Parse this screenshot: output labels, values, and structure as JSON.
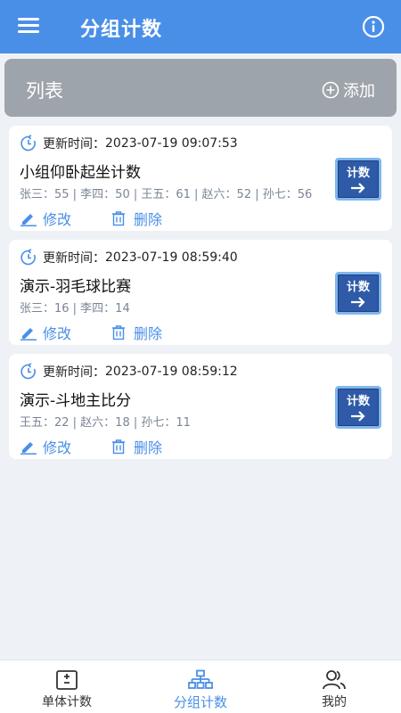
{
  "appbar": {
    "title": "分组计数"
  },
  "list_header": {
    "title": "列表",
    "add_label": "添加"
  },
  "colors": {
    "primary": "#4a8fe7",
    "header_bg": "#9ea4ab",
    "count_button": "#2f5aa8"
  },
  "cards": [
    {
      "time_label": "更新时间：",
      "time": "2023-07-19 09:07:53",
      "name": "小组仰卧起坐计数",
      "scores": "张三：55 | 李四：50 | 王五：61 | 赵六：52 | 孙七：56",
      "edit_label": "修改",
      "delete_label": "删除",
      "count_label": "计数"
    },
    {
      "time_label": "更新时间：",
      "time": "2023-07-19 08:59:40",
      "name": "演示-羽毛球比赛",
      "scores": "张三：16 | 李四：14",
      "edit_label": "修改",
      "delete_label": "删除",
      "count_label": "计数"
    },
    {
      "time_label": "更新时间：",
      "time": "2023-07-19 08:59:12",
      "name": "演示-斗地主比分",
      "scores": "王五：22 | 赵六：18 | 孙七：11",
      "edit_label": "修改",
      "delete_label": "删除",
      "count_label": "计数"
    }
  ],
  "bottom_nav": {
    "items": [
      {
        "label": "单体计数",
        "icon": "counter-icon"
      },
      {
        "label": "分组计数",
        "icon": "group-tree-icon",
        "active": true
      },
      {
        "label": "我的",
        "icon": "users-icon"
      }
    ]
  }
}
